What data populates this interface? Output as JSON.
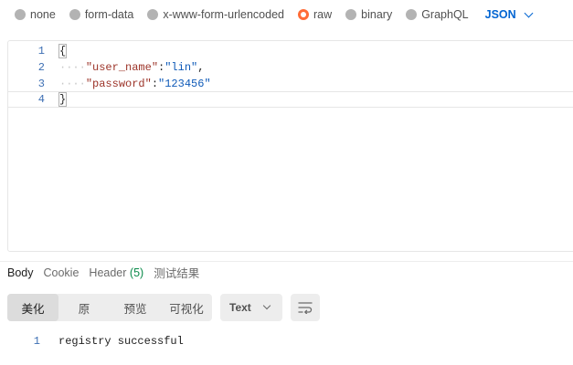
{
  "body_types": [
    {
      "label": "none",
      "selected": false
    },
    {
      "label": "form-data",
      "selected": false
    },
    {
      "label": "x-www-form-urlencoded",
      "selected": false
    },
    {
      "label": "raw",
      "selected": true
    },
    {
      "label": "binary",
      "selected": false
    },
    {
      "label": "GraphQL",
      "selected": false
    }
  ],
  "language_select": {
    "value": "JSON",
    "icon": "chevron-down-icon"
  },
  "editor": {
    "lines": [
      {
        "number": "1",
        "text": "{"
      },
      {
        "number": "2",
        "guide": "····",
        "key": "\"user_name\"",
        "sep": ":",
        "value": "\"lin\"",
        "trail": ","
      },
      {
        "number": "3",
        "guide": "····",
        "key": "\"password\"",
        "sep": ":",
        "value": "\"123456\"",
        "trail": ""
      },
      {
        "number": "4",
        "text": "}"
      }
    ]
  },
  "response_tabs": [
    {
      "label": "Body",
      "active": true
    },
    {
      "label": "Cookie",
      "active": false
    },
    {
      "label": "Header",
      "count": "(5)",
      "active": false
    },
    {
      "label": "测试结果",
      "active": false
    }
  ],
  "view_modes": [
    {
      "label": "美化",
      "active": true
    },
    {
      "label": "原",
      "active": false
    },
    {
      "label": "预览",
      "active": false
    },
    {
      "label": "可视化",
      "active": false
    }
  ],
  "format_select": {
    "value": "Text",
    "icon": "chevron-down-icon"
  },
  "wrap_button": {
    "icon": "wrap-lines-icon"
  },
  "response": {
    "lines": [
      {
        "number": "1",
        "text": "registry successful"
      }
    ]
  },
  "colors": {
    "accent": "#ff6c37",
    "link_blue": "#0265d2",
    "json_key": "#9c3328",
    "json_string": "#0f5ab8",
    "count_green": "#0a8a4a"
  }
}
